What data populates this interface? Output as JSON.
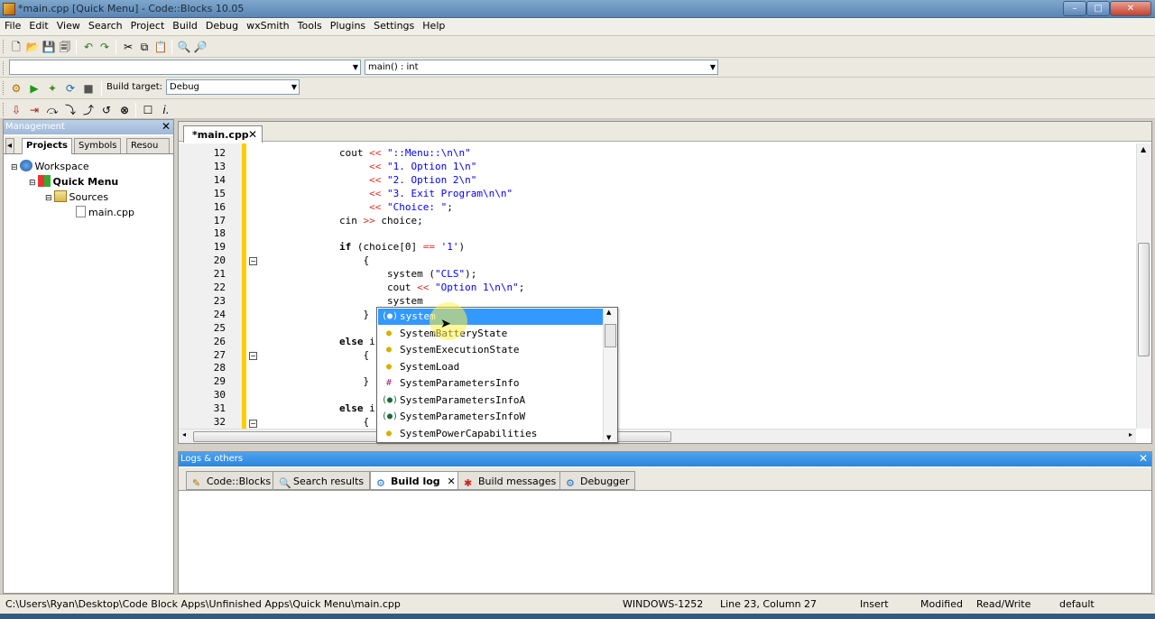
{
  "window": {
    "title": "*main.cpp [Quick Menu] - Code::Blocks 10.05",
    "min": "–",
    "max": "□",
    "close": "✕"
  },
  "menu": [
    "File",
    "Edit",
    "View",
    "Search",
    "Project",
    "Build",
    "Debug",
    "wxSmith",
    "Tools",
    "Plugins",
    "Settings",
    "Help"
  ],
  "toolbar": {
    "symbol_combo": "main() : int",
    "build_target_label": "Build target:",
    "build_target": "Debug"
  },
  "management": {
    "title": "Management",
    "close": "✕",
    "tabs": [
      "Projects",
      "Symbols",
      "Resou"
    ],
    "workspace": "Workspace",
    "project": "Quick Menu",
    "sources": "Sources",
    "file": "main.cpp"
  },
  "editor": {
    "tab": "*main.cpp",
    "tab_close": "✕",
    "line_numbers": [
      "12",
      "13",
      "14",
      "15",
      "16",
      "17",
      "18",
      "19",
      "20",
      "21",
      "22",
      "23",
      "24",
      "25",
      "26",
      "27",
      "28",
      "29",
      "30",
      "31",
      "32"
    ],
    "lines": [
      "cout << \"::Menu::\\n\\n\"",
      "     << \"1. Option 1\\n\"",
      "     << \"2. Option 2\\n\"",
      "     << \"3. Exit Program\\n\\n\"",
      "     << \"Choice: \";",
      "cin >> choice;",
      "",
      "if (choice[0] == '1')",
      "    {",
      "        system (\"CLS\");",
      "        cout << \"Option 1\\n\\n\";",
      "        system",
      "    }",
      "",
      "else i",
      "    {",
      "",
      "    }",
      "",
      "else i",
      "    {"
    ]
  },
  "autocomplete": {
    "items": [
      {
        "icon": "(●)",
        "label": "system"
      },
      {
        "icon": "●",
        "label": "SystemBatteryState"
      },
      {
        "icon": "●",
        "label": "SystemExecutionState"
      },
      {
        "icon": "●",
        "label": "SystemLoad"
      },
      {
        "icon": "#",
        "label": "SystemParametersInfo"
      },
      {
        "icon": "(●)",
        "label": "SystemParametersInfoA"
      },
      {
        "icon": "(●)",
        "label": "SystemParametersInfoW"
      },
      {
        "icon": "●",
        "label": "SystemPowerCapabilities"
      }
    ]
  },
  "logs": {
    "title": "Logs & others",
    "close": "✕",
    "tabs": [
      "Code::Blocks",
      "Search results",
      "Build log",
      "Build messages",
      "Debugger"
    ],
    "tab_close": "✕"
  },
  "status": {
    "path": "C:\\Users\\Ryan\\Desktop\\Code Block Apps\\Unfinished Apps\\Quick Menu\\main.cpp",
    "encoding": "WINDOWS-1252",
    "position": "Line 23, Column 27",
    "mode": "Insert",
    "modified": "Modified",
    "access": "Read/Write",
    "lang": "default"
  }
}
